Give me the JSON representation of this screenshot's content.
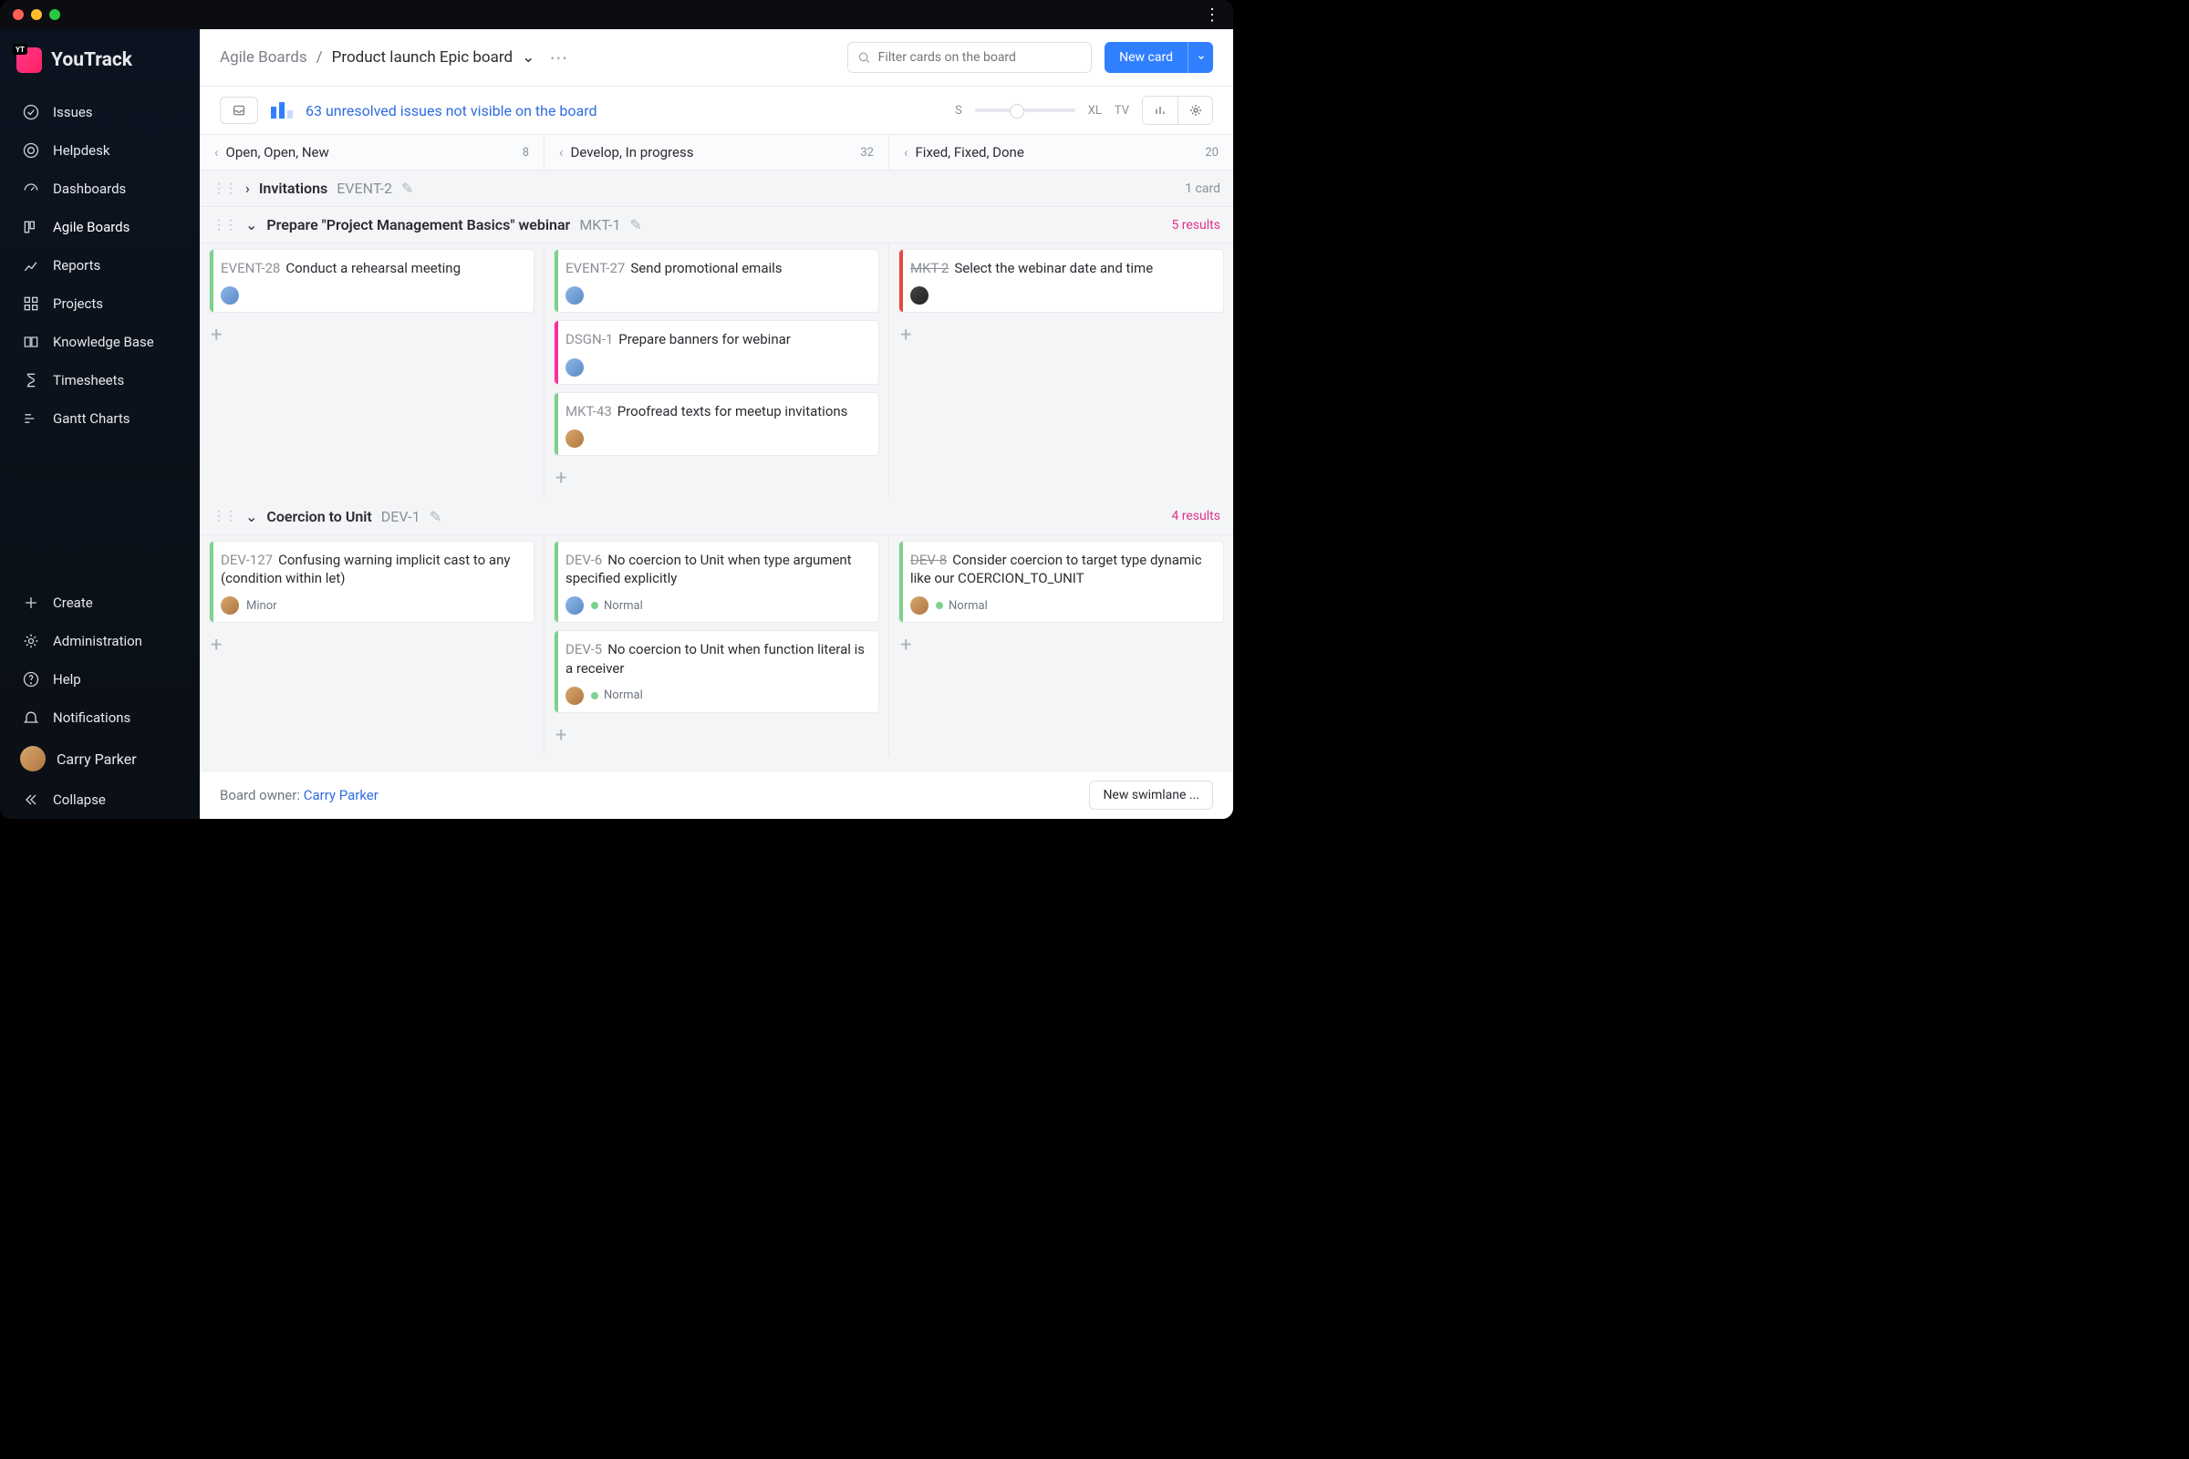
{
  "app": {
    "name": "YouTrack",
    "logo_badge": "YT"
  },
  "sidebar": {
    "items": [
      {
        "label": "Issues"
      },
      {
        "label": "Helpdesk"
      },
      {
        "label": "Dashboards"
      },
      {
        "label": "Agile Boards"
      },
      {
        "label": "Reports"
      },
      {
        "label": "Projects"
      },
      {
        "label": "Knowledge Base"
      },
      {
        "label": "Timesheets"
      },
      {
        "label": "Gantt Charts"
      }
    ],
    "footer": [
      {
        "label": "Create"
      },
      {
        "label": "Administration"
      },
      {
        "label": "Help"
      },
      {
        "label": "Notifications"
      }
    ],
    "user": "Carry Parker",
    "collapse": "Collapse"
  },
  "header": {
    "crumb_root": "Agile Boards",
    "crumb_sep": "/",
    "crumb_current": "Product launch Epic board",
    "search_placeholder": "Filter cards on the board",
    "new_card": "New card"
  },
  "toolbar": {
    "info_link": "63 unresolved issues not visible on the board",
    "size_s": "S",
    "size_xl": "XL",
    "size_tv": "TV"
  },
  "columns": [
    {
      "label": "Open, Open, New",
      "count": "8"
    },
    {
      "label": "Develop, In progress",
      "count": "32"
    },
    {
      "label": "Fixed, Fixed, Done",
      "count": "20"
    }
  ],
  "swimlanes": [
    {
      "title": "Invitations",
      "key": "EVENT-2",
      "collapsed": true,
      "meta": "1 card"
    },
    {
      "title": "Prepare \"Project Management Basics\" webinar",
      "key": "MKT-1",
      "results": "5 results",
      "cells": [
        [
          {
            "key": "EVENT-28",
            "title": "Conduct a rehearsal meeting",
            "color": "green",
            "av": "b1"
          }
        ],
        [
          {
            "key": "EVENT-27",
            "title": "Send promotional emails",
            "color": "green",
            "av": "b1"
          },
          {
            "key": "DSGN-1",
            "title": "Prepare banners for webinar",
            "color": "pink",
            "av": "b1"
          },
          {
            "key": "MKT-43",
            "title": "Proofread texts for meetup invitations",
            "color": "green",
            "av": "b2"
          }
        ],
        [
          {
            "key": "MKT-2",
            "title": "Select the webinar date and time",
            "color": "red",
            "strike": true,
            "av": "b3"
          }
        ]
      ]
    },
    {
      "title": "Coercion to Unit",
      "key": "DEV-1",
      "results": "4 results",
      "cells": [
        [
          {
            "key": "DEV-127",
            "title": "Confusing warning implicit cast to any (condition within let)",
            "color": "green",
            "av": "b2",
            "priority": "Minor"
          }
        ],
        [
          {
            "key": "DEV-6",
            "title": "No coercion to Unit when type argument specified explicitly",
            "color": "green",
            "av": "b1",
            "priority": "Normal",
            "pdot": true
          },
          {
            "key": "DEV-5",
            "title": "No coercion to Unit when function literal is a receiver",
            "color": "green",
            "av": "b2",
            "priority": "Normal",
            "pdot": true
          }
        ],
        [
          {
            "key": "DEV-8",
            "title": "Consider coercion to target type dynamic like our COERCION_TO_UNIT",
            "color": "green",
            "strike": true,
            "av": "b2",
            "priority": "Normal",
            "pdot": true
          }
        ]
      ]
    }
  ],
  "footer": {
    "owner_label": "Board owner: ",
    "owner_name": "Carry Parker",
    "new_swimlane": "New swimlane ..."
  }
}
